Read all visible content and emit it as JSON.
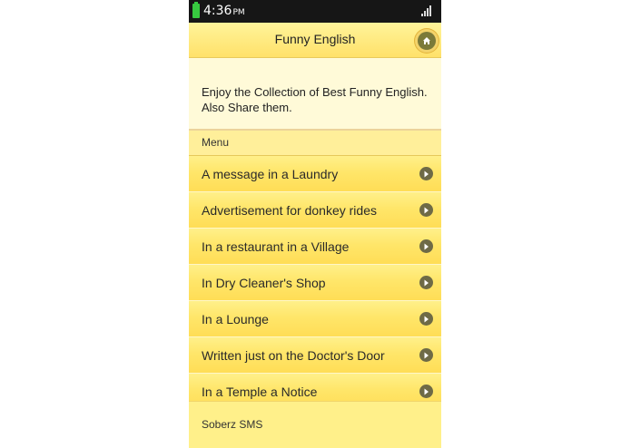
{
  "status_bar": {
    "time": "4:36",
    "ampm": "PM"
  },
  "header": {
    "title": "Funny English",
    "home_icon": "home-icon"
  },
  "intro": {
    "text": "Enjoy the Collection of Best Funny English. Also Share them."
  },
  "menu": {
    "divider_label": "Menu",
    "items": [
      {
        "label": "A message in a Laundry"
      },
      {
        "label": "Advertisement for donkey rides"
      },
      {
        "label": "In a restaurant in a Village"
      },
      {
        "label": "In Dry Cleaner's Shop"
      },
      {
        "label": "In a Lounge"
      },
      {
        "label": "Written just on the Doctor's Door"
      },
      {
        "label": "In a Temple a Notice"
      }
    ]
  },
  "footer": {
    "text": "Soberz SMS"
  },
  "colors": {
    "header_bg": "#ffe16a",
    "item_bg": "#ffe66a",
    "content_bg": "#fffad8",
    "statusbar_bg": "#161616"
  }
}
